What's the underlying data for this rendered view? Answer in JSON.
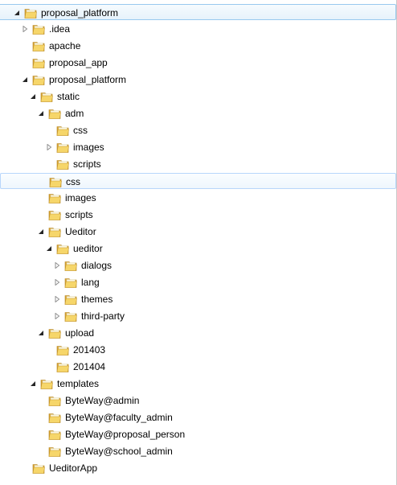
{
  "tree": {
    "nodes": [
      {
        "key": "proposal-platform-root",
        "label": "proposal_platform",
        "state": "expanded",
        "highlight": "selected"
      },
      {
        "key": "idea",
        "label": ".idea",
        "state": "collapsed"
      },
      {
        "key": "apache",
        "label": "apache",
        "state": "leaf"
      },
      {
        "key": "proposal-app",
        "label": "proposal_app",
        "state": "leaf"
      },
      {
        "key": "proposal-platform",
        "label": "proposal_platform",
        "state": "expanded"
      },
      {
        "key": "static",
        "label": "static",
        "state": "expanded"
      },
      {
        "key": "adm",
        "label": "adm",
        "state": "expanded"
      },
      {
        "key": "adm-css",
        "label": "css",
        "state": "leaf"
      },
      {
        "key": "adm-images",
        "label": "images",
        "state": "collapsed"
      },
      {
        "key": "adm-scripts",
        "label": "scripts",
        "state": "leaf"
      },
      {
        "key": "css",
        "label": "css",
        "state": "leaf",
        "highlight": "hover"
      },
      {
        "key": "images",
        "label": "images",
        "state": "leaf"
      },
      {
        "key": "scripts",
        "label": "scripts",
        "state": "leaf"
      },
      {
        "key": "ueditor-parent",
        "label": "Ueditor",
        "state": "expanded"
      },
      {
        "key": "ueditor",
        "label": "ueditor",
        "state": "expanded"
      },
      {
        "key": "dialogs",
        "label": "dialogs",
        "state": "collapsed"
      },
      {
        "key": "lang",
        "label": "lang",
        "state": "collapsed"
      },
      {
        "key": "themes",
        "label": "themes",
        "state": "collapsed"
      },
      {
        "key": "third-party",
        "label": "third-party",
        "state": "collapsed"
      },
      {
        "key": "upload",
        "label": "upload",
        "state": "expanded"
      },
      {
        "key": "upload-201403",
        "label": "201403",
        "state": "leaf"
      },
      {
        "key": "upload-201404",
        "label": "201404",
        "state": "leaf"
      },
      {
        "key": "templates",
        "label": "templates",
        "state": "expanded"
      },
      {
        "key": "byteway-admin",
        "label": "ByteWay@admin",
        "state": "leaf"
      },
      {
        "key": "byteway-faculty-admin",
        "label": "ByteWay@faculty_admin",
        "state": "leaf"
      },
      {
        "key": "byteway-proposal-person",
        "label": "ByteWay@proposal_person",
        "state": "leaf"
      },
      {
        "key": "byteway-school-admin",
        "label": "ByteWay@school_admin",
        "state": "leaf"
      },
      {
        "key": "ueditor-app",
        "label": "UeditorApp",
        "state": "leaf"
      }
    ]
  },
  "colors": {
    "selected_bg": "#e6f2fb",
    "selected_border": "#99c9ef",
    "hover_bg": "#eef6fd",
    "hover_border": "#b8d6fb",
    "folder_back": "#d9a637",
    "folder_front": "#f6d66a",
    "folder_paper": "#fbf6df",
    "toggle_expanded": "#262626",
    "toggle_collapsed": "#8f8f8f"
  }
}
